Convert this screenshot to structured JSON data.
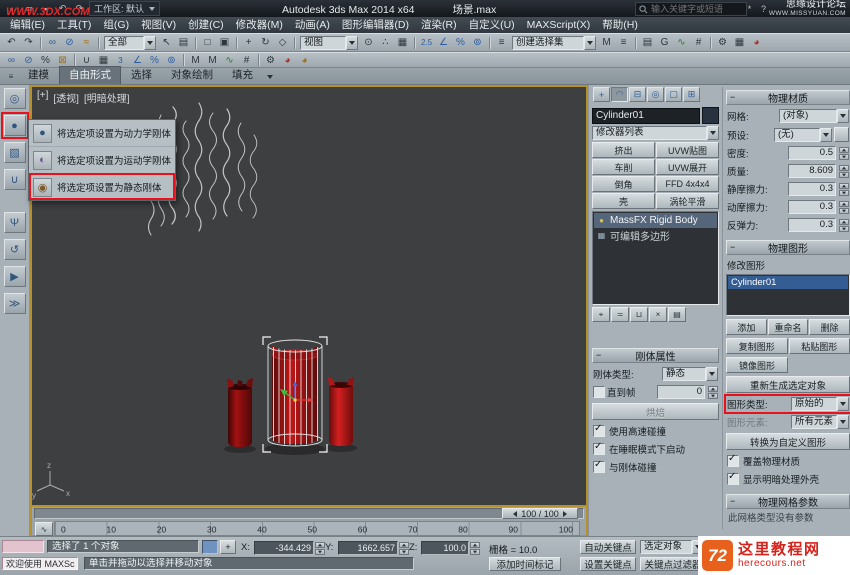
{
  "colors": {
    "annotation_red": "#e8111c",
    "viewport_border": "#b5912e",
    "selection_blue": "#335d93",
    "object_red": "#b01414"
  },
  "watermarks": {
    "top_left": "WWW.3DX.COM",
    "top_right_line1": "思缘设计论坛",
    "top_right_line2": "WWW.MISSYUAN.COM",
    "bottom_right_site": "这里教程网",
    "bottom_right_url": "herecours.net",
    "bottom_right_logo": "72"
  },
  "title_bar": {
    "workspace": "工作区: 默认",
    "title": "Autodesk 3ds Max  2014 x64",
    "document": "场景.max",
    "search_placeholder": "输入关键字或短语"
  },
  "menus": [
    "编辑(E)",
    "工具(T)",
    "组(G)",
    "视图(V)",
    "创建(C)",
    "修改器(M)",
    "动画(A)",
    "图形编辑器(D)",
    "渲染(R)",
    "自定义(U)",
    "MAXScript(X)",
    "帮助(H)"
  ],
  "toolbar": {
    "selection_filter": "全部",
    "coord_system": "视图",
    "named_selection": "创建选择集",
    "snap_mode": "2.5",
    "snap_mode_2": "3"
  },
  "ribbon": {
    "tabs": [
      "建模",
      "自由形式",
      "选择",
      "对象绘制",
      "填充"
    ]
  },
  "flyout": {
    "items": [
      "将选定项设置为动力学刚体",
      "将选定项设置为运动学刚体",
      "将选定项设置为静态刚体"
    ]
  },
  "viewport": {
    "menu_token": "[+]",
    "view_token": "[透视]",
    "shading_token": "[明暗处理]",
    "axis_x": "x",
    "axis_y": "y",
    "axis_z": "z"
  },
  "panel": {
    "object_name": "Cylinder01",
    "modifier_list": "修改器列表",
    "modifier_buttons": [
      "挤出",
      "UVW贴图",
      "车削",
      "UVW展开",
      "倒角",
      "FFD 4x4x4",
      "壳",
      "涡轮平滑"
    ],
    "stack": [
      "MassFX Rigid Body",
      "可编辑多边形"
    ],
    "rigid": {
      "title": "刚体属性",
      "type_label": "刚体类型:",
      "type_value": "静态",
      "until_label": "直到帧",
      "until_value": "0",
      "bake": "烘焙",
      "opt1": "使用高速碰撞",
      "opt2": "在睡眠模式下启动",
      "opt3": "与刚体碰撞"
    },
    "mat": {
      "title": "物理材质",
      "mesh_label": "网格:",
      "mesh_value": "(对象)",
      "preset_label": "预设:",
      "preset_value": "(无)",
      "density_label": "密度:",
      "density_value": "0.5",
      "mass_label": "质量:",
      "mass_value": "8.609",
      "sfric_label": "静摩擦力:",
      "sfric_value": "0.3",
      "dfric_label": "动摩擦力:",
      "dfric_value": "0.3",
      "bounce_label": "反弹力:",
      "bounce_value": "0.3"
    },
    "shapes": {
      "title": "物理图形",
      "modify_label": "修改图形",
      "item": "Cylinder01",
      "add": "添加",
      "rename": "重命名",
      "delete": "删除",
      "copy": "复制图形",
      "paste": "粘贴图形",
      "mirror": "镜像图形",
      "regen": "重新生成选定对象",
      "type_label": "图形类型:",
      "type_value": "原始的",
      "element_label": "图形元素:",
      "element_value": "所有元素",
      "convert": "转换为自定义图形",
      "override": "覆盖物理材质",
      "display": "显示明暗处理外壳"
    },
    "mesh_params": {
      "title": "物理网格参数",
      "note": "此网格类型没有参数"
    }
  },
  "timeline": {
    "slider": "100 / 100",
    "ticks": [
      "0",
      "10",
      "20",
      "30",
      "40",
      "50",
      "60",
      "70",
      "80",
      "90",
      "100"
    ]
  },
  "status": {
    "selection": "选择了 1 个对象",
    "x_label": "X:",
    "x_value": "-344.429",
    "y_label": "Y:",
    "y_value": "1662.657",
    "z_label": "Z:",
    "z_value": "100.0",
    "grid": "栅格 = 10.0",
    "auto_key": "自动关键点",
    "set_key": "设置关键点",
    "selection_filter": "选定对象",
    "key_filters": "关键点过滤器...",
    "listener": "欢迎使用 MAXSc",
    "prompt": "单击并拖动以选择并移动对象",
    "add_time_tag": "添加时间标记"
  },
  "icons": {
    "new": "▫",
    "open": "▱",
    "save": "▪",
    "undo": "↶",
    "redo": "↷",
    "help": "?",
    "star": "*",
    "link": "∞",
    "unlink": "⊘",
    "bind": "≈",
    "select": "↖",
    "by_name": "▤",
    "region": "□",
    "crossing": "▣",
    "move": "+",
    "rotate": "↻",
    "scale": "◇",
    "pivot": "⊙",
    "manipulate": "∴",
    "keyboard": "▦",
    "snap": "2.5",
    "snap3": "3",
    "angle": "∠",
    "percent": "%",
    "spinner": "⊚",
    "sets": "≡",
    "mirror": "M",
    "align": "≡",
    "layers": "▤",
    "graphite": "G",
    "curve": "∿",
    "schematic": "#",
    "rsetup": "⚙",
    "rframe": "▦",
    "render": "◕",
    "lock": "⊠",
    "hand": "∪",
    "m": "M",
    "teapot": "◕",
    "world": "◎",
    "rigid": "●",
    "mcloth": "▨",
    "constraint": "∪",
    "ragdoll": "Ψ",
    "reset": "↺",
    "play": "▶",
    "step": "≫",
    "tab_create": "+",
    "tab_modify": "◠",
    "tab_hier": "⊟",
    "tab_motion": "◎",
    "tab_display": "▢",
    "tab_util": "⊞",
    "pin": "⌖",
    "endres": "≍",
    "unique": "⊔",
    "remove": "×",
    "config": "▤",
    "bulb": "●",
    "poly": "▦",
    "sphere1": "●",
    "sphere2": "◐",
    "sphere3": "◉",
    "minicurve": "∿"
  }
}
